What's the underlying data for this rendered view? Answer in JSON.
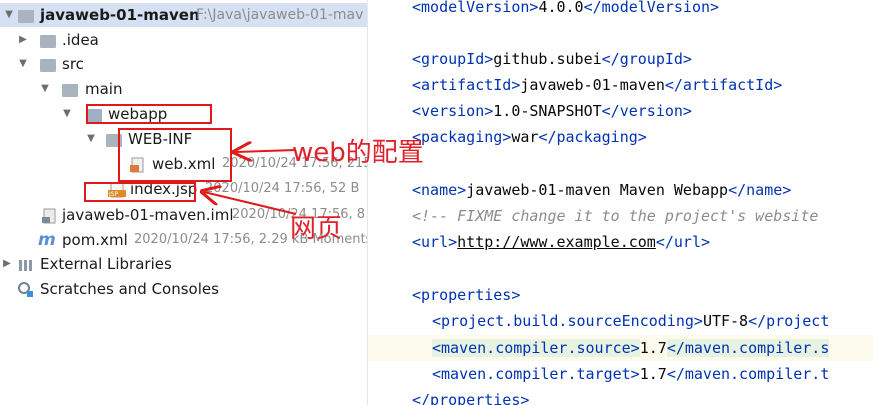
{
  "project_tree": {
    "root": {
      "name": "javaweb-01-maven",
      "path": "F:\\Java\\javaweb-01-mav"
    },
    "idea": {
      "name": ".idea"
    },
    "src": {
      "name": "src"
    },
    "main": {
      "name": "main"
    },
    "webapp": {
      "name": "webapp"
    },
    "webinf": {
      "name": "WEB-INF"
    },
    "webxml": {
      "name": "web.xml",
      "meta": "2020/10/24 17:56, 215"
    },
    "indexjsp": {
      "name": "index.jsp",
      "meta": "2020/10/24 17:56, 52 B"
    },
    "iml": {
      "name": "javaweb-01-maven.iml",
      "meta": "2020/10/24 17:56, 8"
    },
    "pom": {
      "name": "pom.xml",
      "meta": "2020/10/24 17:56, 2.29 kB Moments"
    },
    "external": {
      "name": "External Libraries"
    },
    "scratches": {
      "name": "Scratches and Consoles"
    }
  },
  "annotations": {
    "web_config": "web的配置",
    "web_page": "网页"
  },
  "icons": {
    "folder": "folder-icon",
    "xml": "xml-file-icon",
    "jsp": "jsp-file-icon",
    "maven": "maven-icon"
  },
  "editor": {
    "l1": {
      "o": "<modelVersion>",
      "t": "4.0.0",
      "c": "</modelVersion>"
    },
    "l2": {
      "o": "<groupId>",
      "t": "github.subei",
      "c": "</groupId>"
    },
    "l3": {
      "o": "<artifactId>",
      "t": "javaweb-01-maven",
      "c": "</artifactId>"
    },
    "l4": {
      "o": "<version>",
      "t": "1.0-SNAPSHOT",
      "c": "</version>"
    },
    "l5": {
      "o": "<packaging>",
      "t": "war",
      "c": "</packaging>"
    },
    "l6": {
      "o": "<name>",
      "t": "javaweb-01-maven Maven Webapp",
      "c": "</name>"
    },
    "l7": {
      "comment": "<!-- FIXME change it to the project's website"
    },
    "l8": {
      "o": "<url>",
      "t": "http://www.example.com",
      "c": "</url>"
    },
    "l9": {
      "o": "<properties>"
    },
    "l10": {
      "o": "<project.build.sourceEncoding>",
      "t": "UTF-8",
      "c": "</project"
    },
    "l11": {
      "o": "<maven.compiler.source>",
      "t": "1.7",
      "c": "</maven.compiler.s"
    },
    "l12": {
      "o": "<maven.compiler.target>",
      "t": "1.7",
      "c": "</maven.compiler.t"
    },
    "l13": {
      "o": "</properties>"
    }
  }
}
